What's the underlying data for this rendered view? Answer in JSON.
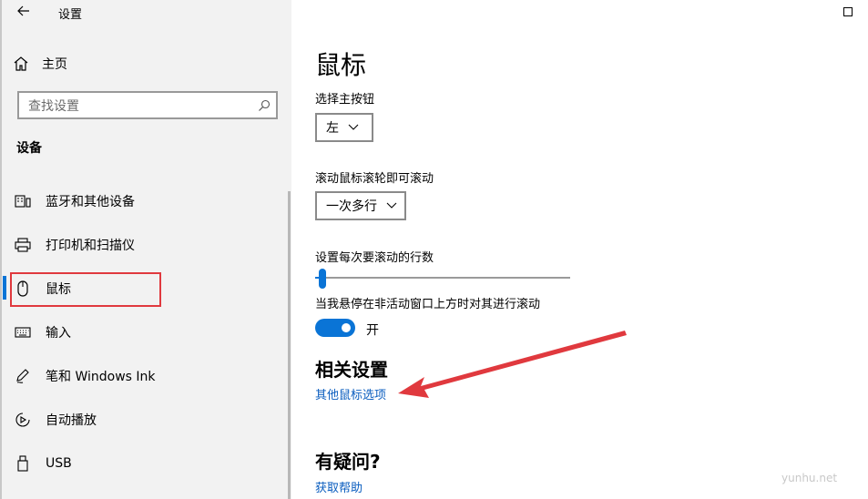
{
  "window": {
    "title": "设置"
  },
  "sidebar": {
    "home_label": "主页",
    "search_placeholder": "查找设置",
    "section_title": "设备",
    "items": [
      {
        "label": "蓝牙和其他设备",
        "icon": "bluetooth-devices-icon"
      },
      {
        "label": "打印机和扫描仪",
        "icon": "printer-icon"
      },
      {
        "label": "鼠标",
        "icon": "mouse-icon",
        "selected": true
      },
      {
        "label": "输入",
        "icon": "keyboard-icon"
      },
      {
        "label": "笔和 Windows Ink",
        "icon": "pen-icon"
      },
      {
        "label": "自动播放",
        "icon": "autoplay-icon"
      },
      {
        "label": "USB",
        "icon": "usb-icon"
      }
    ]
  },
  "main": {
    "page_title": "鼠标",
    "primary_button": {
      "label": "选择主按钮",
      "value": "左"
    },
    "scroll_mode": {
      "label": "滚动鼠标滚轮即可滚动",
      "value": "一次多行"
    },
    "scroll_lines": {
      "label": "设置每次要滚动的行数",
      "level": 0.03
    },
    "inactive_scroll": {
      "label": "当我悬停在非活动窗口上方时对其进行滚动",
      "state": "开"
    },
    "related": {
      "title": "相关设置",
      "link": "其他鼠标选项"
    },
    "help": {
      "title": "有疑问?",
      "link": "获取帮助"
    }
  },
  "colors": {
    "accent": "#0a74d6",
    "annotation": "#e0393e",
    "link": "#0a5dbf"
  },
  "watermark": "yunhu.net"
}
